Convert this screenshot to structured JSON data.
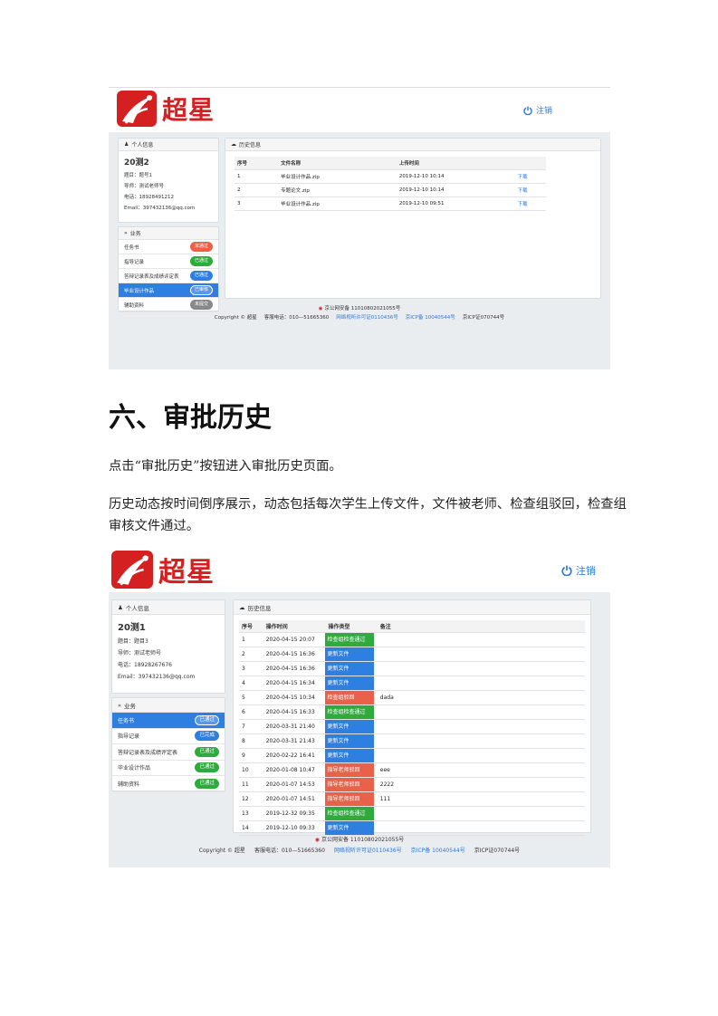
{
  "colors": {
    "brand_red": "#d42020",
    "link_blue": "#2e78d6",
    "active_blue": "#2f7fe0",
    "status_green": "#2faa3c",
    "status_red": "#e8624a",
    "status_blue": "#2f7fe0",
    "status_gray": "#888888"
  },
  "screenshot1": {
    "logo_text": "超星",
    "logout_label": "注销",
    "profile": {
      "header": "个人信息",
      "name": "20测2",
      "topic": "题目：题号1",
      "advisor": "导师：测试老师号",
      "phone": "电话：18928491212",
      "email": "Email：397432136@qq.com"
    },
    "business": {
      "header": "业务",
      "items": [
        {
          "label": "任务书",
          "badge": "未通过",
          "badge_color": "#e8624a",
          "active": false
        },
        {
          "label": "指导记录",
          "badge": "已通过",
          "badge_color": "#2faa3c",
          "active": false
        },
        {
          "label": "答辩记录表及成绩评定表",
          "badge": "已通过",
          "badge_color": "#2f7fe0",
          "active": false
        },
        {
          "label": "毕业设计作品",
          "badge": "已审核",
          "badge_color": "#2f7fe0",
          "active": true
        },
        {
          "label": "辅助资料",
          "badge": "未提交",
          "badge_color": "#888888",
          "active": false
        }
      ]
    },
    "history": {
      "header": "历史信息",
      "columns": [
        "序号",
        "文件名称",
        "上传时间",
        ""
      ],
      "rows": [
        {
          "no": "1",
          "file": "毕业设计作品.zip",
          "time": "2019-12-10 10:14",
          "action": "下载"
        },
        {
          "no": "2",
          "file": "专题论文.zip",
          "time": "2019-12-10 10:14",
          "action": "下载"
        },
        {
          "no": "3",
          "file": "毕业设计作品.zip",
          "time": "2019-12-10 09:51",
          "action": "下载"
        }
      ]
    },
    "footer": {
      "icp_record": "京公网安备 11010802021055号",
      "copyright": "Copyright © 超星",
      "phone": "客服电话：010—51665360",
      "license1": "网络视听许可证0110436号",
      "license2": "京ICP备 10040544号",
      "license3": "京ICP证070744号"
    }
  },
  "document": {
    "section_title": "六、审批历史",
    "para1": "点击“审批历史”按钮进入审批历史页面。",
    "para2_line1": "历史动态按时间倒序展示，动态包括每次学生上传文件，文件被老师、检查组驳回，检查组",
    "para2_line2": "审核文件通过。"
  },
  "screenshot2": {
    "logo_text": "超星",
    "logout_label": "注销",
    "profile": {
      "header": "个人信息",
      "name": "20测1",
      "topic": "题目：题目3",
      "advisor": "导师：测试老师号",
      "phone": "电话：18928267676",
      "email": "Email：397432136@qq.com"
    },
    "business": {
      "header": "业务",
      "items": [
        {
          "label": "任务书",
          "badge": "已通过",
          "badge_color": "#2f7fe0",
          "active": true
        },
        {
          "label": "指导记录",
          "badge": "已完成",
          "badge_color": "#2f7fe0",
          "active": false
        },
        {
          "label": "答辩记录表及成绩评定表",
          "badge": "已通过",
          "badge_color": "#2faa3c",
          "active": false
        },
        {
          "label": "毕业设计作品",
          "badge": "已通过",
          "badge_color": "#2faa3c",
          "active": false
        },
        {
          "label": "辅助资料",
          "badge": "已通过",
          "badge_color": "#2faa3c",
          "active": false
        }
      ]
    },
    "history": {
      "header": "历史信息",
      "columns": [
        "序号",
        "操作时间",
        "操作类型",
        "备注"
      ],
      "rows": [
        {
          "no": "1",
          "time": "2020-04-15 20:07",
          "op": "检查组检查通过",
          "op_color": "#2faa3c",
          "note": ""
        },
        {
          "no": "2",
          "time": "2020-04-15 16:36",
          "op": "更新文件",
          "op_color": "#2f7fe0",
          "note": ""
        },
        {
          "no": "3",
          "time": "2020-04-15 16:36",
          "op": "更新文件",
          "op_color": "#2f7fe0",
          "note": ""
        },
        {
          "no": "4",
          "time": "2020-04-15 16:34",
          "op": "更新文件",
          "op_color": "#2f7fe0",
          "note": ""
        },
        {
          "no": "5",
          "time": "2020-04-15 10:34",
          "op": "检查组驳回",
          "op_color": "#e8624a",
          "note": "dada"
        },
        {
          "no": "6",
          "time": "2020-04-15 16:33",
          "op": "检查组检查通过",
          "op_color": "#2faa3c",
          "note": ""
        },
        {
          "no": "7",
          "time": "2020-03-31 21:40",
          "op": "更新文件",
          "op_color": "#2f7fe0",
          "note": ""
        },
        {
          "no": "8",
          "time": "2020-03-31 21:43",
          "op": "更新文件",
          "op_color": "#2f7fe0",
          "note": ""
        },
        {
          "no": "9",
          "time": "2020-02-22 16:41",
          "op": "更新文件",
          "op_color": "#2f7fe0",
          "note": ""
        },
        {
          "no": "10",
          "time": "2020-01-08 10:47",
          "op": "指导老师驳回",
          "op_color": "#e8624a",
          "note": "eee"
        },
        {
          "no": "11",
          "time": "2020-01-07 14:53",
          "op": "指导老师驳回",
          "op_color": "#e8624a",
          "note": "2222"
        },
        {
          "no": "12",
          "time": "2020-01-07 14:51",
          "op": "指导老师驳回",
          "op_color": "#e8624a",
          "note": "111"
        },
        {
          "no": "13",
          "time": "2019-12-32 09:35",
          "op": "检查组检查通过",
          "op_color": "#2faa3c",
          "note": ""
        },
        {
          "no": "14",
          "time": "2019-12-10 09:33",
          "op": "更新文件",
          "op_color": "#2f7fe0",
          "note": ""
        }
      ]
    },
    "footer": {
      "icp_record": "京公网安备 11010802021055号",
      "copyright": "Copyright © 超星",
      "phone": "客服电话：010—51665360",
      "license1": "网络视听许可证0110436号",
      "license2": "京ICP备 10040544号",
      "license3": "京ICP证070744号"
    }
  }
}
